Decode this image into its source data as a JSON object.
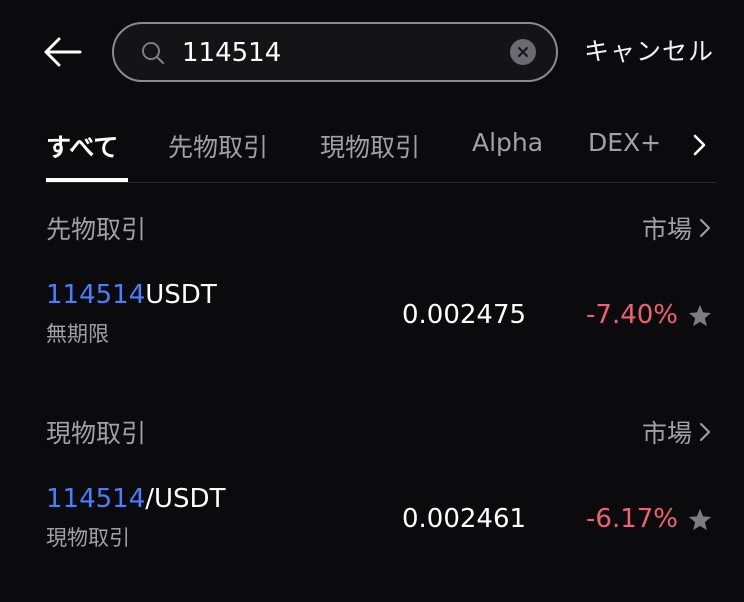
{
  "search": {
    "value": "114514",
    "cancel_label": "キャンセル"
  },
  "tabs": [
    {
      "label": "すべて",
      "active": true
    },
    {
      "label": "先物取引",
      "active": false
    },
    {
      "label": "現物取引",
      "active": false
    },
    {
      "label": "Alpha",
      "active": false
    },
    {
      "label": "DEX+",
      "active": false
    }
  ],
  "sections": [
    {
      "title": "先物取引",
      "market_label": "市場",
      "results": [
        {
          "query_match": "114514",
          "rest": "USDT",
          "sub_label": "無期限",
          "price": "0.002475",
          "change": "-7.40%"
        }
      ]
    },
    {
      "title": "現物取引",
      "market_label": "市場",
      "results": [
        {
          "query_match": "114514",
          "rest": "/USDT",
          "sub_label": "現物取引",
          "price": "0.002461",
          "change": "-6.17%"
        }
      ]
    }
  ],
  "colors": {
    "background": "#0b0b0d",
    "highlight": "#4a7dff",
    "negative": "#f0616d",
    "muted": "#a0a0a6"
  },
  "icons": {
    "back": "arrow-left-icon",
    "search": "search-icon",
    "clear": "clear-icon",
    "more": "chevron-right-icon",
    "favorite": "star-icon"
  }
}
